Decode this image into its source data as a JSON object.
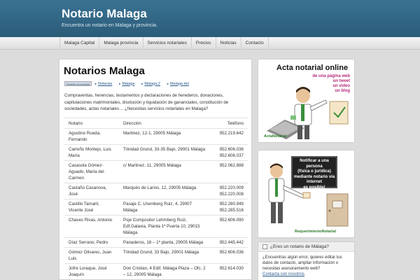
{
  "header": {
    "site_title": "Notario Malaga",
    "tagline": "Encuentra un notario en Malaga y provincia."
  },
  "nav": {
    "items": [
      {
        "label": "Malaga Capital"
      },
      {
        "label": "Malaga provincia"
      },
      {
        "label": "Servicios notariales"
      },
      {
        "label": "Precios"
      },
      {
        "label": "Noticias"
      },
      {
        "label": "Contacto"
      }
    ]
  },
  "main": {
    "title": "Notarios Malaga",
    "breadcrumb": {
      "badge": "Gestión provincias",
      "links": [
        "Notarias",
        "Malaga",
        "Malaga 2",
        "Malaga del"
      ]
    },
    "intro": "Compraventas, herencias, testamentos y declaraciones de herederos, donaciones, capitulaciones matrimoniales, disolución y liquidación de gananciales, constitución de sociedades, actas notariales… ¿Necesitas servicios notariales en Malaga?",
    "table": {
      "headers": {
        "name": "Notario",
        "address": "Dirección",
        "phone": "Teléfono"
      },
      "rows": [
        {
          "name": "Agustino Rueda, Fernando",
          "address": "Martinez, 12-1, 29005 Málaga",
          "phone": "952.219.642"
        },
        {
          "name": "Carreño Montejo, Luis María",
          "address": "Trinidad Grund, 33-35 Bajo, 29001 Málaga",
          "phone": "952.606.036 952.606.037"
        },
        {
          "name": "Casasola Gómez-Aguado, María del Carmen",
          "address": "c/ Martinez, 11, 29005 Málaga",
          "phone": "952.062.888"
        },
        {
          "name": "Castaño Casanova, José",
          "address": "Marqués de Larios, 12, 29005 Málaga",
          "phone": "952.220.009 952.220.008"
        },
        {
          "name": "Castillo Tamarit, Vicente José",
          "address": "Pasaje C. Lhemberg Ruiz, 4, 29007 Málaga",
          "phone": "952.280.949 952.285.516"
        },
        {
          "name": "Chaves Rivas, Antonio",
          "address": "Psje Compositor Lehmberg Ruiz, Edf.Galaxia, Planta 1ª Puerta 10, 29015 Málaga",
          "phone": "952.606.090"
        },
        {
          "name": "Díaz Serrano, Pedro",
          "address": "Panaderos, 18 – 1ª planta, 29005 Málaga",
          "phone": "952.445.442"
        },
        {
          "name": "Gómez Olivares, Juan Luis",
          "address": "Trinidad Grund, 33 Bajo, 29001 Málaga",
          "phone": "952.606.036"
        },
        {
          "name": "Jofre Loraque, José Joaquín",
          "address": "Don Cristian, 4 Edif. Málaga Plaza – Ofc. 2 – 12, 29005 Málaga",
          "phone": "952.614.030"
        }
      ]
    }
  },
  "sidebar": {
    "ad1": {
      "title": "Acta notarial online",
      "sub": [
        "de una página web",
        "un tweet",
        "un video",
        "un blog"
      ],
      "logo": "ActaNotarial"
    },
    "ad2": {
      "sign": [
        "Notificar a una persona",
        "(física o jurídica)",
        "mediante notario vía internet",
        "es posible!"
      ],
      "logo": "RequerimientoNotarial"
    },
    "info": {
      "heading": "¿Eres un notario de Málaga?",
      "body": "¿Encuentras algún error, quieres editar tus datos de contacto, ampliar información o necesitas asesoramiento web?",
      "link": "Contacta con nosotros"
    }
  },
  "colors": {
    "header": "#2b5c78",
    "link": "#2a5a8a",
    "accent_pink": "#b7287a",
    "logo_green": "#2a7a2a"
  }
}
